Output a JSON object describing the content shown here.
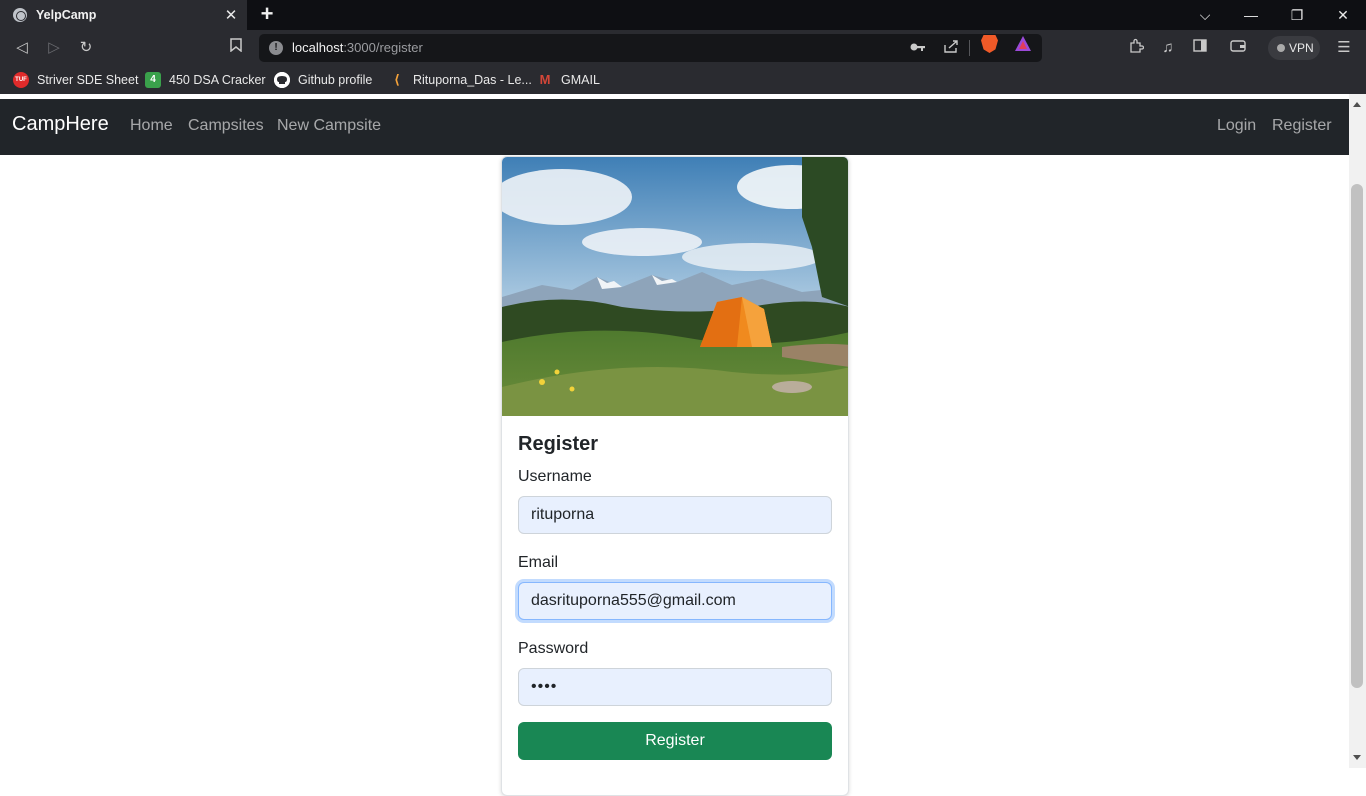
{
  "browser": {
    "tab": {
      "title": "YelpCamp",
      "close": "✕"
    },
    "new_tab": "+",
    "url_host": "localhost",
    "url_rest": ":3000/register",
    "vpn_label": "VPN",
    "window_controls": {
      "tabs_menu": "⌵",
      "minimize": "—",
      "restore": "❐",
      "close": "✕"
    },
    "icons": [
      "back-icon",
      "forward-icon",
      "reload-icon",
      "bookmark-icon",
      "key-icon",
      "share-icon",
      "brave-shields-icon",
      "brave-rewards-icon",
      "extensions-icon",
      "media-icon",
      "sidebar-icon",
      "wallet-icon",
      "menu-icon"
    ]
  },
  "bookmarks": [
    {
      "label": "Striver SDE Sheet",
      "icon": "TUF",
      "color": "#e02b2b"
    },
    {
      "label": "450 DSA Cracker",
      "icon": "4",
      "color": "#3aa14b"
    },
    {
      "label": "Github profile",
      "icon": "gh",
      "color": "#ffffff"
    },
    {
      "label": "Rituporna_Das - Le...",
      "icon": "lc",
      "color": "#f4a23a"
    },
    {
      "label": "GMAIL",
      "icon": "M",
      "color": "#d44638"
    }
  ],
  "navbar": {
    "brand": "CampHere",
    "links": [
      "Home",
      "Campsites",
      "New Campsite"
    ],
    "right_links": [
      "Login",
      "Register"
    ]
  },
  "form": {
    "title": "Register",
    "username_label": "Username",
    "username_value": "rituporna",
    "email_label": "Email",
    "email_value": "dasrituporna555@gmail.com",
    "password_label": "Password",
    "password_value": "••••",
    "submit_label": "Register"
  }
}
